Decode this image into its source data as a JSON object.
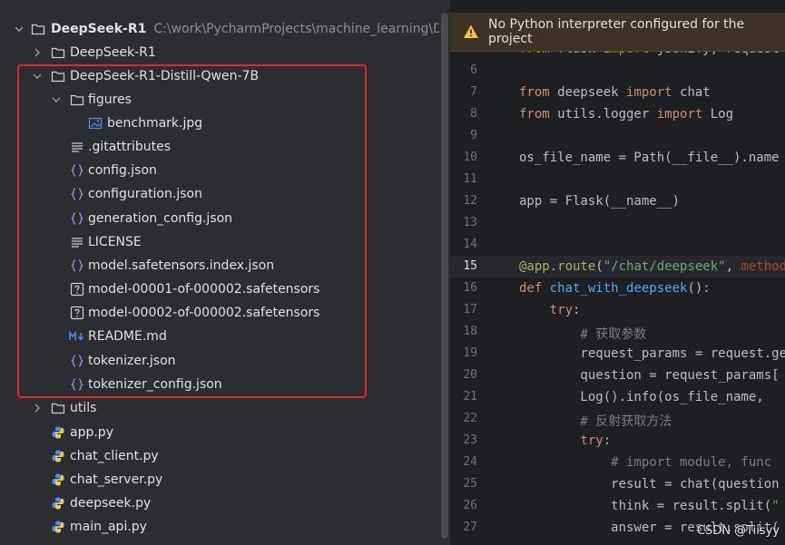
{
  "project_tree": {
    "root": {
      "name": "DeepSeek-R1",
      "path": "C:\\work\\PycharmProjects\\machine_learning\\DeepSeek-"
    },
    "items": [
      {
        "label": "DeepSeek-R1",
        "type": "folder",
        "expanded": false
      },
      {
        "label": "DeepSeek-R1-Distill-Qwen-7B",
        "type": "folder",
        "expanded": true
      },
      {
        "label": "figures",
        "type": "folder",
        "expanded": true
      },
      {
        "label": "benchmark.jpg",
        "type": "image"
      },
      {
        "label": ".gitattributes",
        "type": "text"
      },
      {
        "label": "config.json",
        "type": "json"
      },
      {
        "label": "configuration.json",
        "type": "json"
      },
      {
        "label": "generation_config.json",
        "type": "json"
      },
      {
        "label": "LICENSE",
        "type": "text"
      },
      {
        "label": "model.safetensors.index.json",
        "type": "json"
      },
      {
        "label": "model-00001-of-000002.safetensors",
        "type": "unknown"
      },
      {
        "label": "model-00002-of-000002.safetensors",
        "type": "unknown"
      },
      {
        "label": "README.md",
        "type": "markdown"
      },
      {
        "label": "tokenizer.json",
        "type": "json"
      },
      {
        "label": "tokenizer_config.json",
        "type": "json"
      },
      {
        "label": "utils",
        "type": "folder",
        "expanded": false
      },
      {
        "label": "app.py",
        "type": "python"
      },
      {
        "label": "chat_client.py",
        "type": "python"
      },
      {
        "label": "chat_server.py",
        "type": "python"
      },
      {
        "label": "deepseek.py",
        "type": "python"
      },
      {
        "label": "main_api.py",
        "type": "python"
      }
    ]
  },
  "banner": {
    "text": "No Python interpreter configured for the project",
    "icon": "warning-icon"
  },
  "editor": {
    "current_line": "15",
    "lines": [
      {
        "num": "5",
        "text": "from flask import jsonify, request"
      },
      {
        "num": "6",
        "text": ""
      },
      {
        "num": "7",
        "text": "from deepseek import chat"
      },
      {
        "num": "8",
        "text": "from utils.logger import Log"
      },
      {
        "num": "9",
        "text": ""
      },
      {
        "num": "10",
        "text": "os_file_name = Path(__file__).name"
      },
      {
        "num": "11",
        "text": ""
      },
      {
        "num": "12",
        "text": "app = Flask(__name__)"
      },
      {
        "num": "13",
        "text": ""
      },
      {
        "num": "14",
        "text": ""
      },
      {
        "num": "15",
        "text": "@app.route(\"/chat/deepseek\", methods"
      },
      {
        "num": "16",
        "text": "def chat_with_deepseek():"
      },
      {
        "num": "17",
        "text": "    try:"
      },
      {
        "num": "18",
        "text": "        # 获取参数"
      },
      {
        "num": "19",
        "text": "        request_params = request.get_"
      },
      {
        "num": "20",
        "text": "        question = request_params["
      },
      {
        "num": "21",
        "text": "        Log().info(os_file_name, "
      },
      {
        "num": "22",
        "text": "        # 反射获取方法"
      },
      {
        "num": "23",
        "text": "        try:"
      },
      {
        "num": "24",
        "text": "            # import module, func"
      },
      {
        "num": "25",
        "text": "            result = chat(question"
      },
      {
        "num": "26",
        "text": "            think = result.split(\""
      },
      {
        "num": "27",
        "text": "            answer = result.split("
      }
    ]
  },
  "watermark": "CSDN @Tiisyy",
  "colors": {
    "highlight_border": "#e02b2b",
    "banner_bg": "#3d3223",
    "editor_bg": "#1e1f22",
    "tree_bg": "#2b2d30"
  }
}
